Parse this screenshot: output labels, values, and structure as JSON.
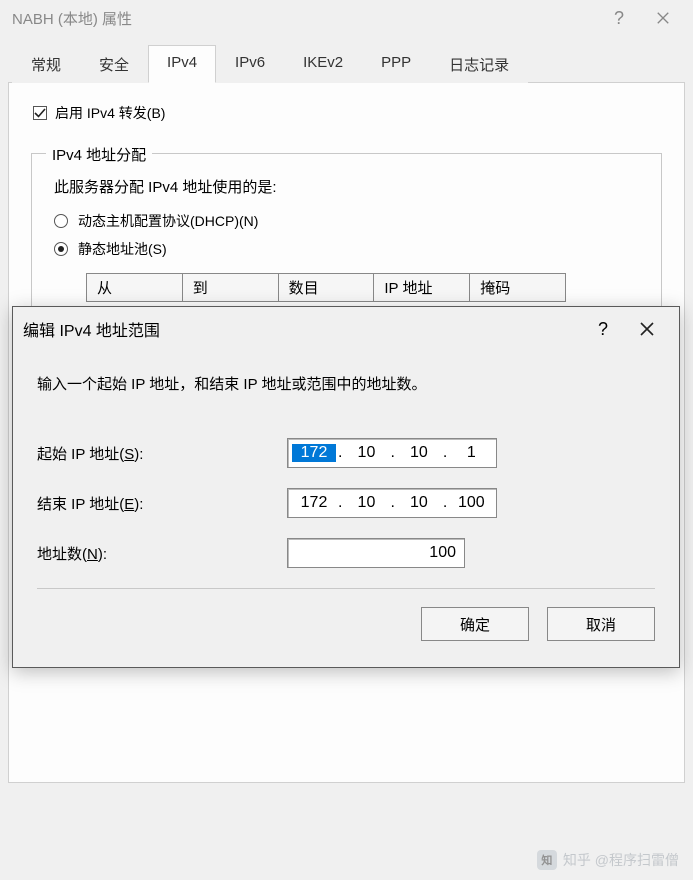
{
  "window": {
    "title": "NABH (本地) 属性",
    "help_glyph": "?",
    "tabs": [
      {
        "label": "常规"
      },
      {
        "label": "安全"
      },
      {
        "label": "IPv4",
        "active": true
      },
      {
        "label": "IPv6"
      },
      {
        "label": "IKEv2"
      },
      {
        "label": "PPP"
      },
      {
        "label": "日志记录"
      }
    ]
  },
  "ipv4": {
    "enable_forward_label": "启用 IPv4 转发(B)",
    "enable_forward_checked": true,
    "assign_group_title": "IPv4 地址分配",
    "assign_desc": "此服务器分配 IPv4 地址使用的是:",
    "radio_dhcp_label": "动态主机配置协议(DHCP)(N)",
    "radio_static_label": "静态地址池(S)",
    "radio_selected": "static",
    "table_headers": {
      "from": "从",
      "to": "到",
      "count": "数目",
      "ip": "IP 地址",
      "mask": "掩码"
    }
  },
  "modal": {
    "title": "编辑 IPv4 地址范围",
    "help_glyph": "?",
    "desc": "输入一个起始 IP 地址，和结束 IP 地址或范围中的地址数。",
    "start_label_pre": "起始 IP 地址(",
    "start_label_key": "S",
    "start_label_post": "):",
    "end_label_pre": "结束 IP 地址(",
    "end_label_key": "E",
    "end_label_post": "):",
    "count_label_pre": "地址数(",
    "count_label_key": "N",
    "count_label_post": "):",
    "start_ip": {
      "o1": "172",
      "o2": "10",
      "o3": "10",
      "o4": "1"
    },
    "end_ip": {
      "o1": "172",
      "o2": "10",
      "o3": "10",
      "o4": "100"
    },
    "count_value": "100",
    "ok_label": "确定",
    "cancel_label": "取消"
  },
  "watermark": {
    "logo_text": "知",
    "text": "知乎 @程序扫雷僧"
  }
}
